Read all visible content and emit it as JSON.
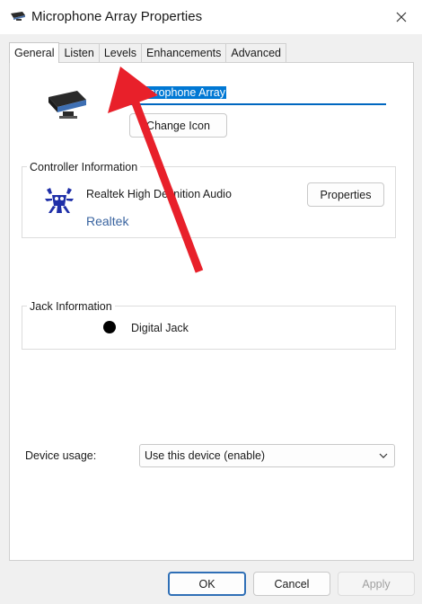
{
  "window": {
    "title": "Microphone Array Properties"
  },
  "tabs": [
    {
      "label": "General",
      "active": true
    },
    {
      "label": "Listen",
      "active": false
    },
    {
      "label": "Levels",
      "active": false
    },
    {
      "label": "Enhancements",
      "active": false
    },
    {
      "label": "Advanced",
      "active": false
    }
  ],
  "general": {
    "device_name_value": "Microphone Array",
    "change_icon_label": "Change Icon",
    "controller": {
      "group_label": "Controller Information",
      "driver_name": "Realtek High Definition Audio",
      "vendor_link": "Realtek",
      "properties_label": "Properties"
    },
    "jack": {
      "group_label": "Jack Information",
      "jack_text": "Digital Jack"
    },
    "device_usage": {
      "label": "Device usage:",
      "selected": "Use this device (enable)"
    }
  },
  "buttons": {
    "ok": "OK",
    "cancel": "Cancel",
    "apply": "Apply"
  },
  "colors": {
    "accent": "#0067c0",
    "annotation_arrow": "#e8202a"
  },
  "icons": {
    "title": "microphone-array-icon",
    "device": "microphone-array-icon",
    "controller": "realtek-crab-icon",
    "close": "close-icon",
    "dropdown": "chevron-down-icon"
  }
}
